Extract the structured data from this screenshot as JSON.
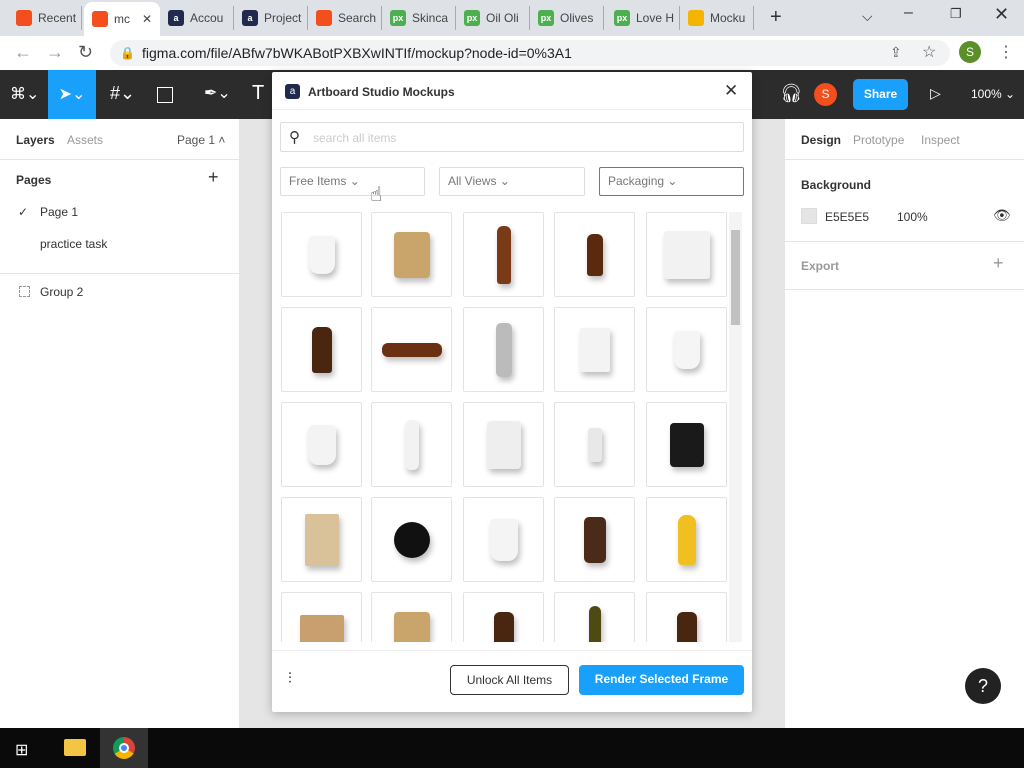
{
  "browser": {
    "tabs": [
      {
        "label": "Recent",
        "icon": "figma-icon",
        "color": "#f24e1e"
      },
      {
        "label": "mc",
        "icon": "figma-icon",
        "color": "#f24e1e",
        "active": true
      },
      {
        "label": "Accou",
        "icon": "artboard-icon",
        "color": "#1f2a4d"
      },
      {
        "label": "Project",
        "icon": "artboard-icon",
        "color": "#1f2a4d"
      },
      {
        "label": "Search",
        "icon": "figma-icon",
        "color": "#f24e1e"
      },
      {
        "label": "Skinca",
        "icon": "px-icon",
        "color": "#4caf50"
      },
      {
        "label": "Oil Oli",
        "icon": "px-icon",
        "color": "#4caf50"
      },
      {
        "label": "Olives",
        "icon": "px-icon",
        "color": "#4caf50"
      },
      {
        "label": "Love H",
        "icon": "px-icon",
        "color": "#4caf50"
      },
      {
        "label": "Mocku",
        "icon": "slides-icon",
        "color": "#f4b400"
      }
    ],
    "url": "figma.com/file/ABfw7bWKABotPXBXwINTIf/mockup?node-id=0%3A1",
    "profile": "S"
  },
  "toolbar": {
    "avatar": "S",
    "share": "Share",
    "zoom": "100%"
  },
  "left": {
    "tab_layers": "Layers",
    "tab_assets": "Assets",
    "page_select": "Page 1",
    "pages_title": "Pages",
    "pages": [
      "Page 1",
      "practice task"
    ],
    "layers": [
      "Group 2"
    ]
  },
  "right": {
    "tab_design": "Design",
    "tab_prototype": "Prototype",
    "tab_inspect": "Inspect",
    "background_title": "Background",
    "bg_hex": "E5E5E5",
    "bg_opacity": "100%",
    "export_title": "Export"
  },
  "modal": {
    "title": "Artboard Studio Mockups",
    "search_placeholder": "search all items",
    "filters": [
      "Free Items",
      "All Views",
      "Packaging"
    ],
    "items": [
      "cup",
      "pouch",
      "beer-bottle",
      "dropper-bottle",
      "bag",
      "pump-bottle",
      "bottle-lying",
      "spray-bottle",
      "box",
      "cup",
      "coffee-cup",
      "tube",
      "chip-bag",
      "small-jar",
      "tin",
      "paper-bag",
      "round-lid",
      "stacked-cups",
      "amber-jar",
      "mustard-bottle",
      "open-box",
      "pouch",
      "pump-bottle",
      "oil-bottle",
      "pump-bottle"
    ],
    "unlock": "Unlock All Items",
    "render": "Render Selected Frame"
  },
  "colors": {
    "accent": "#18a0fb"
  }
}
